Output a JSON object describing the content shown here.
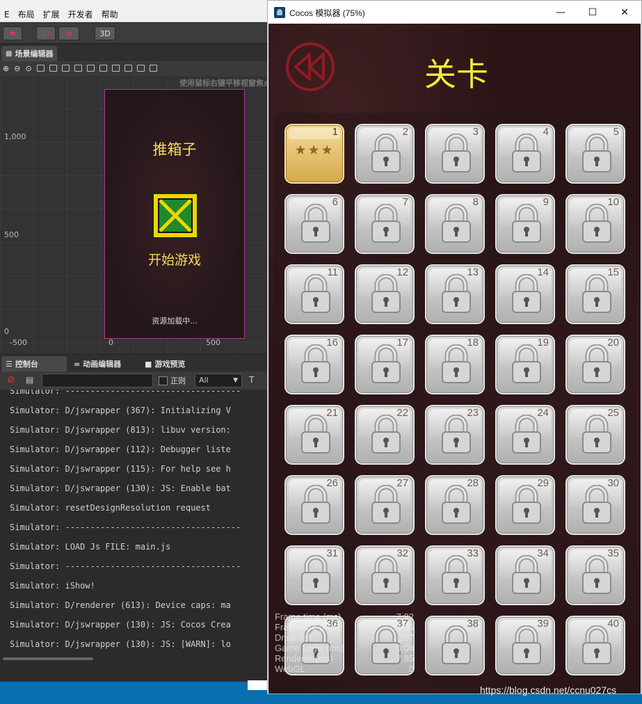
{
  "editor": {
    "menu": [
      "E",
      "布局",
      "扩展",
      "开发者",
      "帮助"
    ],
    "toolbar": {
      "mode_3d": "3D"
    },
    "scene_tab": "场景编辑器",
    "scene_hint": "使用鼠标右键平移视窗焦点",
    "rulers": {
      "y1000": "1,000",
      "y500": "500",
      "y0": "0",
      "xm500": "-500",
      "x0": "0",
      "x500": "500"
    },
    "preview": {
      "title": "推箱子",
      "start": "开始游戏",
      "loading": "资源加载中..."
    },
    "bottom_tabs": [
      "控制台",
      "动画编辑器",
      "游戏预览"
    ],
    "console": {
      "regex_label": "正则",
      "level": "All",
      "lines": [
        "Simulator: -----------------------------------",
        "Simulator: D/jswrapper (367): Initializing V",
        "Simulator: D/jswrapper (813): libuv version:",
        "Simulator: D/jswrapper (112): Debugger liste",
        "Simulator: D/jswrapper (115): For help see h",
        "Simulator: D/jswrapper (130): JS: Enable bat",
        "Simulator: resetDesignResolution request",
        "Simulator: -----------------------------------",
        "Simulator: LOAD Js FILE: main.js",
        "Simulator: -----------------------------------",
        "Simulator: iShow!",
        "Simulator: D/renderer (613): Device caps: ma",
        "Simulator: D/jswrapper (130): JS: Cocos Crea",
        "Simulator: D/jswrapper (130): JS: [WARN]: lo"
      ]
    }
  },
  "simulator": {
    "window_title": "Cocos 模拟器 (75%)",
    "controls": {
      "minimize": "—",
      "maximize": "☐",
      "close": "✕"
    },
    "level_title": "关卡",
    "levels": [
      {
        "n": "1",
        "locked": false,
        "stars": "★★★"
      },
      {
        "n": "2",
        "locked": true
      },
      {
        "n": "3",
        "locked": true
      },
      {
        "n": "4",
        "locked": true
      },
      {
        "n": "5",
        "locked": true
      },
      {
        "n": "6",
        "locked": true
      },
      {
        "n": "7",
        "locked": true
      },
      {
        "n": "8",
        "locked": true
      },
      {
        "n": "9",
        "locked": true
      },
      {
        "n": "10",
        "locked": true
      },
      {
        "n": "11",
        "locked": true
      },
      {
        "n": "12",
        "locked": true
      },
      {
        "n": "13",
        "locked": true
      },
      {
        "n": "14",
        "locked": true
      },
      {
        "n": "15",
        "locked": true
      },
      {
        "n": "16",
        "locked": true
      },
      {
        "n": "17",
        "locked": true
      },
      {
        "n": "18",
        "locked": true
      },
      {
        "n": "19",
        "locked": true
      },
      {
        "n": "20",
        "locked": true
      },
      {
        "n": "21",
        "locked": true
      },
      {
        "n": "22",
        "locked": true
      },
      {
        "n": "23",
        "locked": true
      },
      {
        "n": "24",
        "locked": true
      },
      {
        "n": "25",
        "locked": true
      },
      {
        "n": "26",
        "locked": true
      },
      {
        "n": "27",
        "locked": true
      },
      {
        "n": "28",
        "locked": true
      },
      {
        "n": "29",
        "locked": true
      },
      {
        "n": "30",
        "locked": true
      },
      {
        "n": "31",
        "locked": true
      },
      {
        "n": "32",
        "locked": true
      },
      {
        "n": "33",
        "locked": true
      },
      {
        "n": "34",
        "locked": true
      },
      {
        "n": "35",
        "locked": true
      },
      {
        "n": "36",
        "locked": true
      },
      {
        "n": "37",
        "locked": true
      },
      {
        "n": "38",
        "locked": true
      },
      {
        "n": "39",
        "locked": true
      },
      {
        "n": "40",
        "locked": true
      }
    ],
    "stats": [
      {
        "label": "Frame time (ms)",
        "value": "7.92"
      },
      {
        "label": "Framerate (FPS)",
        "value": "58.66"
      },
      {
        "label": "Draw call",
        "value": "207"
      },
      {
        "label": "Game Logic (ms)",
        "value": "0.08"
      },
      {
        "label": "Renderer (ms)",
        "value": "7.85"
      },
      {
        "label": "WebGL",
        "value": "0"
      }
    ]
  },
  "watermark": "https://blog.csdn.net/ccnu027cs"
}
